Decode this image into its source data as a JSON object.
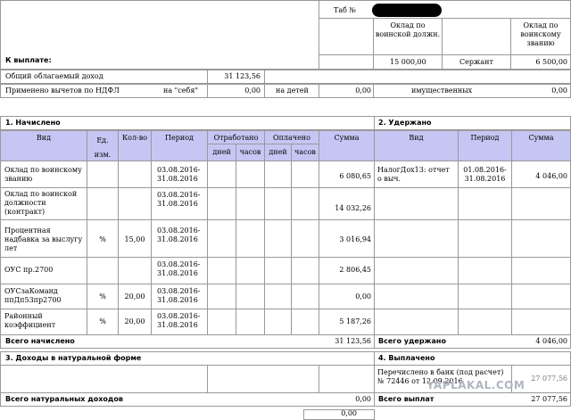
{
  "header": {
    "tab_label": "Таб №",
    "k_vyplate": "К выплате:",
    "col_oklad_dolzh": "Оклад по воинской должн.",
    "col_oklad_zvanie": "Оклад по воинскому званию",
    "oklad_dolzh_value": "15 000,00",
    "rank": "Сержант",
    "oklad_zvanie_value": "6 500,00"
  },
  "income": {
    "label": "Общий облагаемый доход",
    "value": "31 123,56"
  },
  "deductions": {
    "label": "Применено вычетов по НДФЛ",
    "self_label": "на \"себя\"",
    "self_value": "0,00",
    "kids_label": "на детей",
    "kids_value": "0,00",
    "property_label": "имущественных",
    "property_value": "0,00"
  },
  "section1": {
    "title": "1. Начислено",
    "col_vid": "Вид",
    "col_ed": "Ед. изм.",
    "col_kol": "Кол-во",
    "col_period": "Период",
    "col_otrab": "Отработано",
    "col_opl": "Оплачено",
    "col_summa": "Сумма",
    "sub_days": "дней",
    "sub_hours": "часов",
    "rows": [
      {
        "vid": "Оклад по воинскому званию",
        "ed": "",
        "kol": "",
        "period": "03.08.2016-31.08.2016",
        "summa": "6 080,65"
      },
      {
        "vid": "Оклад по воинской должности (контракт)",
        "ed": "",
        "kol": "",
        "period": "03.08.2016-31.08.2016",
        "summa": "14 032,26"
      },
      {
        "vid": "Процентная надбавка за выслугу лет",
        "ed": "%",
        "kol": "15,00",
        "period": "03.08.2016-31.08.2016",
        "summa": "3 016,94"
      },
      {
        "vid": "ОУС пр.2700",
        "ed": "",
        "kol": "",
        "period": "03.08.2016-31.08.2016",
        "summa": "2 806,45"
      },
      {
        "vid": "ОУСзаКоманд ппДп53пр2700",
        "ed": "%",
        "kol": "20,00",
        "period": "03.08.2016-31.08.2016",
        "summa": "0,00"
      },
      {
        "vid": "Районный коэффициент",
        "ed": "%",
        "kol": "20,00",
        "period": "03.08.2016-31.08.2016",
        "summa": "5 187,26"
      }
    ],
    "total_label": "Всего начислено",
    "total_value": "31 123,56"
  },
  "section2": {
    "title": "2. Удержано",
    "col_vid": "Вид",
    "col_period": "Период",
    "col_summa": "Сумма",
    "row_vid": "НалогДох13: отчет о выч.",
    "row_period": "01.08.2016-31.08.2016",
    "row_summa": "4 046,00",
    "total_label": "Всего удержано",
    "total_value": "4 046,00"
  },
  "section3": {
    "title": "3. Доходы в натуральной форме",
    "total_label": "Всего натуральных доходов",
    "total_value": "0,00"
  },
  "section4": {
    "title": "4. Выплачено",
    "row_text": "Перечислено в банк (под расчет) № 72446 от 12.09.2016",
    "row_value": "27 077,56",
    "total_label": "Всего выплат",
    "total_value": "27 077,56"
  },
  "footer_partial": {
    "value": "0,00"
  },
  "watermark": "YAPLAKAL.COM"
}
